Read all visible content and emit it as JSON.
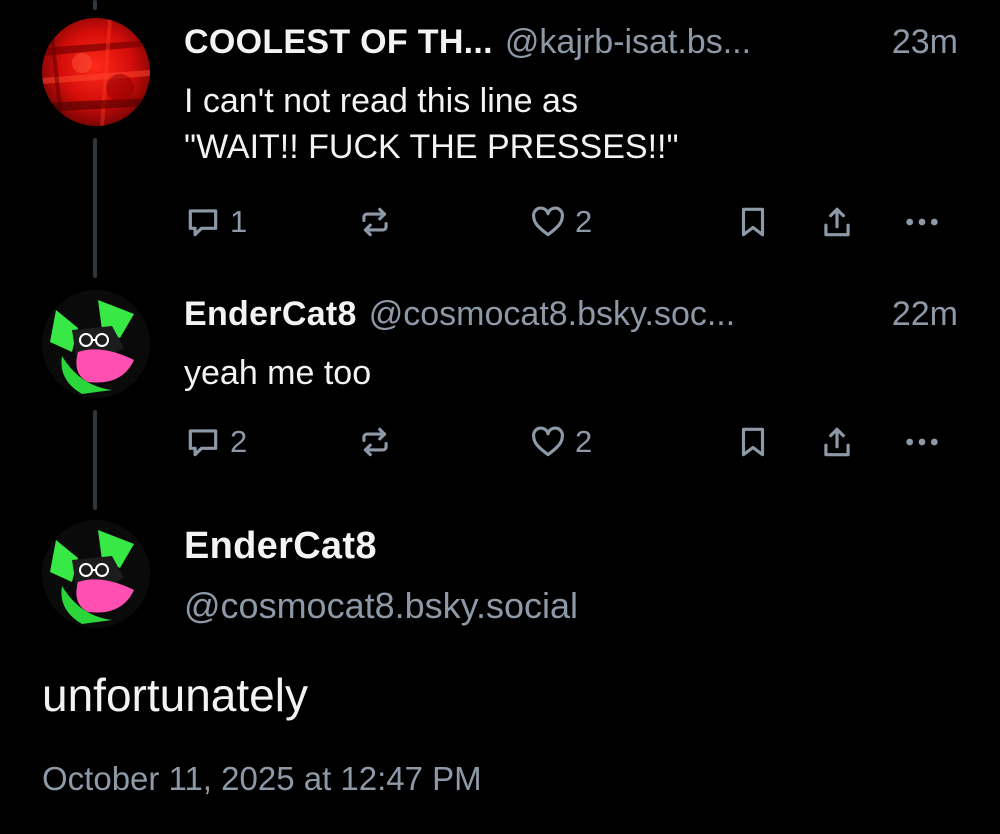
{
  "colors": {
    "background": "#000000",
    "primary_text": "#f1f3f5",
    "secondary_text": "#8d99a6",
    "thread_line": "#2e3640"
  },
  "replies": [
    {
      "display_name": "COOLEST OF TH...",
      "handle": "@kajrb-isat.bs...",
      "time": "23m",
      "text": "I can't not read this line as\n\"WAIT!! FUCK THE PRESSES!!\"",
      "reply_count": "1",
      "repost_count": "",
      "like_count": "2",
      "avatar": "red-texture-avatar"
    },
    {
      "display_name": "EnderCat8",
      "handle": "@cosmocat8.bsky.soc...",
      "time": "22m",
      "text": "yeah me too",
      "reply_count": "2",
      "repost_count": "",
      "like_count": "2",
      "avatar": "green-cat-avatar"
    }
  ],
  "main_post": {
    "display_name": "EnderCat8",
    "handle": "@cosmocat8.bsky.social",
    "text": "unfortunately",
    "date": "October 11, 2025 at 12:47 PM",
    "avatar": "green-cat-avatar"
  },
  "icons": {
    "reply": "speech-bubble-icon",
    "repost": "repost-arrows-icon",
    "like": "heart-icon",
    "bookmark": "bookmark-icon",
    "share": "share-icon",
    "more": "more-dots-icon"
  }
}
